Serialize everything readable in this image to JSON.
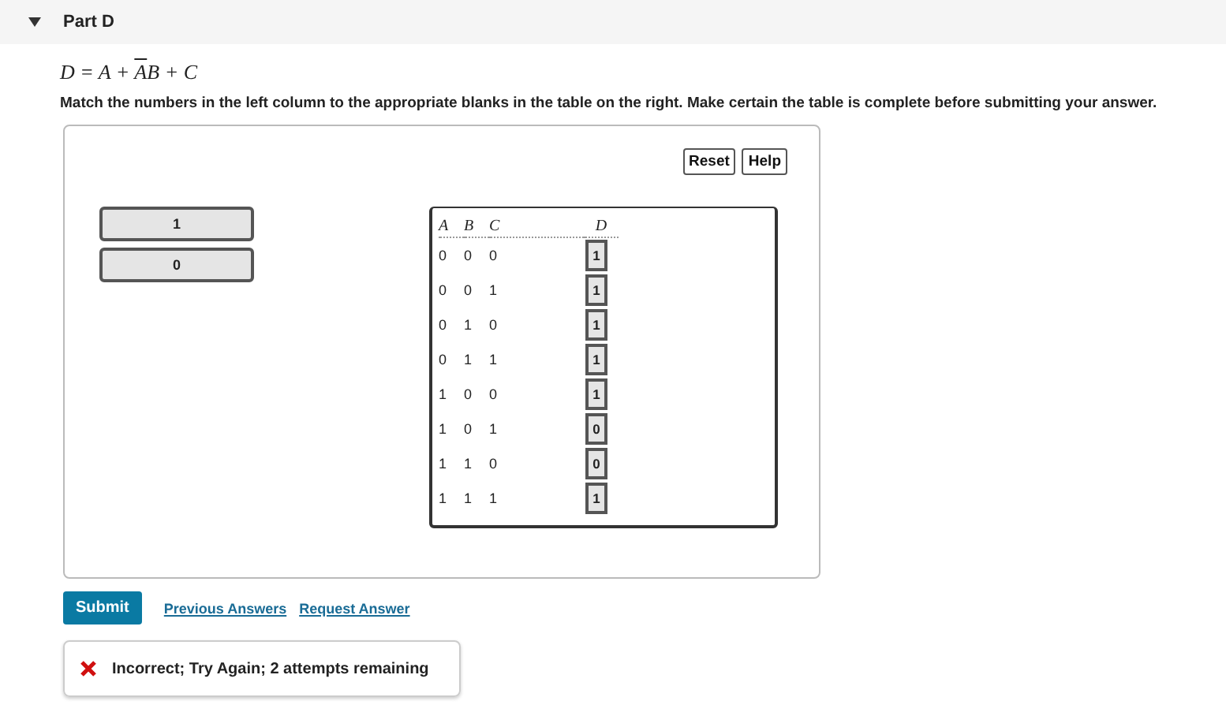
{
  "section": {
    "title": "Part D",
    "expanded": true
  },
  "equation": [
    {
      "text": "D = A + ",
      "overline": false
    },
    {
      "text": "A",
      "overline": true
    },
    {
      "text": "B + C",
      "overline": false
    }
  ],
  "instruction": "Match the numbers in the left column to the appropriate blanks in the table on the right. Make certain the table is complete before submitting your answer.",
  "toolbar": [
    "Reset",
    "Help"
  ],
  "tiles": [
    "1",
    "0"
  ],
  "table": {
    "columns": [
      "A",
      "B",
      "C",
      "D"
    ],
    "rows": [
      [
        "0",
        "0",
        "0",
        "1"
      ],
      [
        "0",
        "0",
        "1",
        "1"
      ],
      [
        "0",
        "1",
        "0",
        "1"
      ],
      [
        "0",
        "1",
        "1",
        "1"
      ],
      [
        "1",
        "0",
        "0",
        "1"
      ],
      [
        "1",
        "0",
        "1",
        "0"
      ],
      [
        "1",
        "1",
        "0",
        "0"
      ],
      [
        "1",
        "1",
        "1",
        "1"
      ]
    ]
  },
  "submit": "Submit",
  "links": [
    "Previous Answers",
    "Request Answer"
  ],
  "feedback": {
    "kind": "error",
    "text": "Incorrect; Try Again; 2 attempts remaining"
  }
}
